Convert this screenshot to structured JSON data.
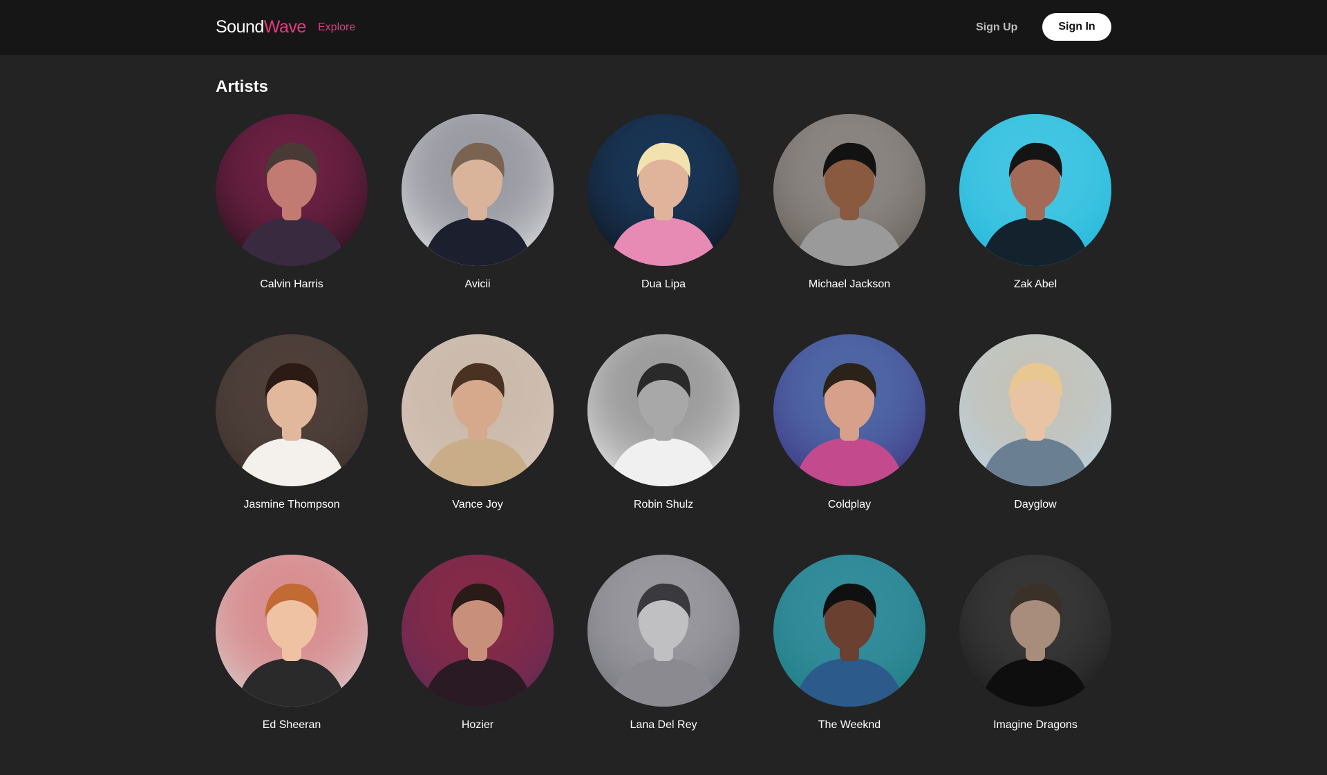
{
  "header": {
    "brand_part1": "Sound",
    "brand_part2": "Wave",
    "nav_explore": "Explore",
    "sign_up": "Sign Up",
    "sign_in": "Sign In"
  },
  "section": {
    "title": "Artists"
  },
  "colors": {
    "accent": "#e8387f",
    "background": "#232323",
    "header_bg": "#161616"
  },
  "artists": [
    {
      "name": "Calvin Harris",
      "bg": "#1a0f14",
      "skin": "#c27b72",
      "hair": "#4a3a35",
      "cloth": "#3a2a40",
      "accent": "#e83a8a"
    },
    {
      "name": "Avicii",
      "bg": "#e9e9ec",
      "skin": "#d9b39a",
      "hair": "#7a6350",
      "cloth": "#1c1f2e",
      "accent": "#1c1f2e"
    },
    {
      "name": "Dua Lipa",
      "bg": "#0e0e14",
      "skin": "#e0b49a",
      "hair": "#f2e2b0",
      "cloth": "#e78bb5",
      "accent": "#2a70b8"
    },
    {
      "name": "Michael Jackson",
      "bg": "#5e5650",
      "skin": "#8a5a40",
      "hair": "#121212",
      "cloth": "#9a9a9a",
      "accent": "#cfcfcf"
    },
    {
      "name": "Zak Abel",
      "bg": "#1fb4d8",
      "skin": "#a46a58",
      "hair": "#151515",
      "cloth": "#13222c",
      "accent": "#77e0f2"
    },
    {
      "name": "Jasmine Thompson",
      "bg": "#3a2e2a",
      "skin": "#e2b89c",
      "hair": "#2c1a14",
      "cloth": "#f4f1ec",
      "accent": "#6d5a52"
    },
    {
      "name": "Vance Joy",
      "bg": "#d8c6b8",
      "skin": "#d6a98c",
      "hair": "#4a3222",
      "cloth": "#c8ad88",
      "accent": "#b7a99a"
    },
    {
      "name": "Robin Shulz",
      "bg": "#f4f4f4",
      "skin": "#a8a8a8",
      "hair": "#2a2a2a",
      "cloth": "#f0f0f0",
      "accent": "#111111"
    },
    {
      "name": "Coldplay",
      "bg": "#3b2a7a",
      "skin": "#d6a08a",
      "hair": "#2b2218",
      "cloth": "#c44a8e",
      "accent": "#6cc4e8"
    },
    {
      "name": "Dayglow",
      "bg": "#b8d4e6",
      "skin": "#e8c4a4",
      "hair": "#e8c890",
      "cloth": "#6a7f92",
      "accent": "#d4a878"
    },
    {
      "name": "Ed Sheeran",
      "bg": "#d8d4d2",
      "skin": "#efc2a4",
      "hair": "#c26a34",
      "cloth": "#2a2a2a",
      "accent": "#d8202a"
    },
    {
      "name": "Hozier",
      "bg": "#5a2a5a",
      "skin": "#c8907a",
      "hair": "#2a1a18",
      "cloth": "#2a1a24",
      "accent": "#c42a2a"
    },
    {
      "name": "Lana Del Rey",
      "bg": "#6e6e76",
      "skin": "#c0c0c2",
      "hair": "#3a3a3e",
      "cloth": "#8a8a90",
      "accent": "#d8d8da"
    },
    {
      "name": "The Weeknd",
      "bg": "#1a7a7e",
      "skin": "#6a4030",
      "hair": "#101010",
      "cloth": "#2c5a8a",
      "accent": "#5aa8c8"
    },
    {
      "name": "Imagine Dragons",
      "bg": "#161616",
      "skin": "#a88c7c",
      "hair": "#3a3228",
      "cloth": "#0e0e0e",
      "accent": "#6a6a6a"
    }
  ]
}
